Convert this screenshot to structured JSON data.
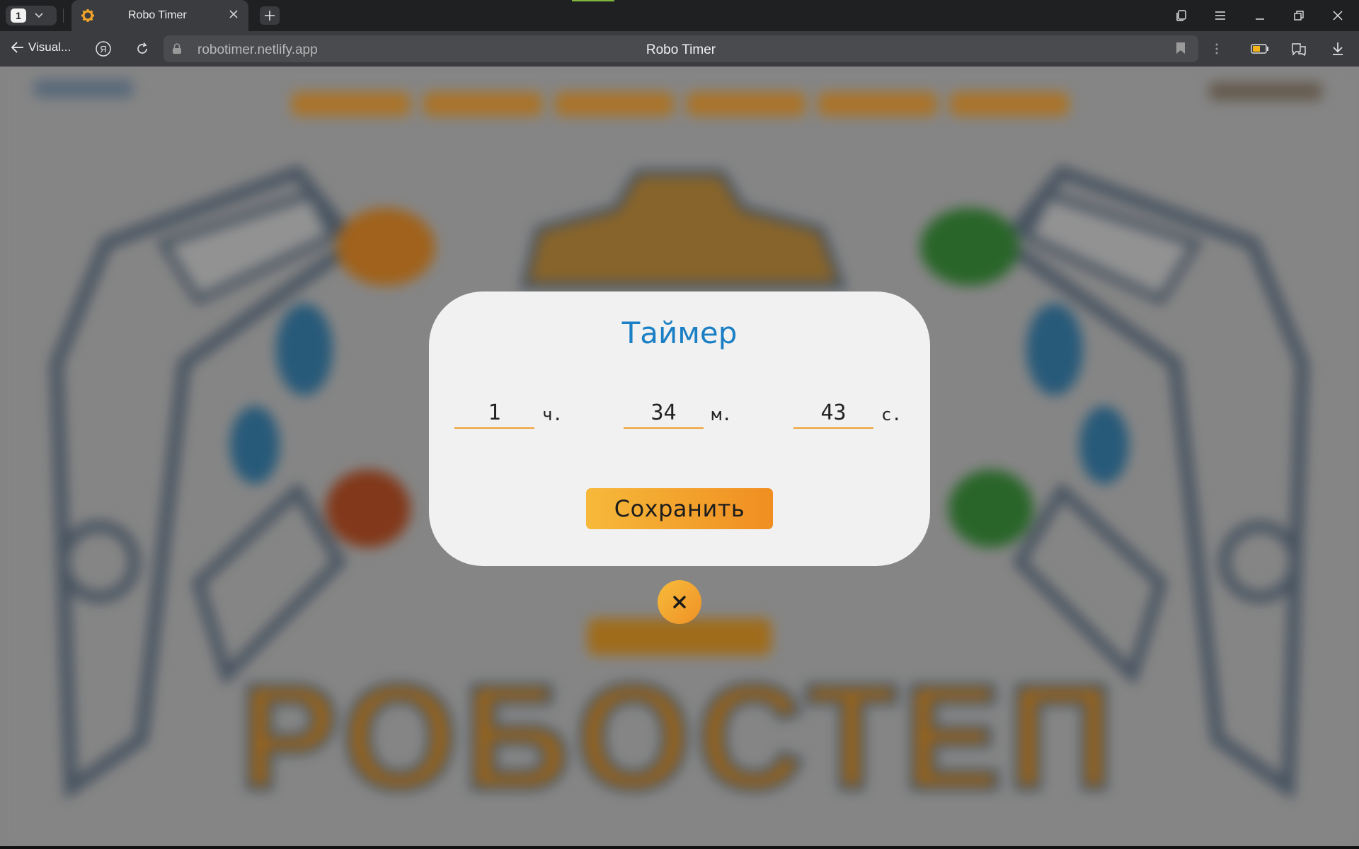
{
  "browser": {
    "tab_count": "1",
    "tab_title": "Robo Timer",
    "back_label": "Visual...",
    "url": "robotimer.netlify.app",
    "page_title": "Robo Timer"
  },
  "background": {
    "logo_text": "РОБОСТЕП"
  },
  "modal": {
    "title": "Таймер",
    "hours": {
      "value": "1",
      "unit": "ч."
    },
    "minutes": {
      "value": "34",
      "unit": "м."
    },
    "seconds": {
      "value": "43",
      "unit": "с."
    },
    "save_label": "Сохранить",
    "close_label": "×"
  },
  "colors": {
    "accent_blue": "#1a7fc4",
    "accent_orange": "#f0a030",
    "modal_bg": "#f1f1f1"
  },
  "icons": [
    "back-arrow-icon",
    "yandex-icon",
    "reload-icon",
    "lock-icon",
    "bookmark-icon",
    "more-icon",
    "battery-icon",
    "translate-icon",
    "download-icon",
    "close-icon",
    "gear-favicon"
  ]
}
